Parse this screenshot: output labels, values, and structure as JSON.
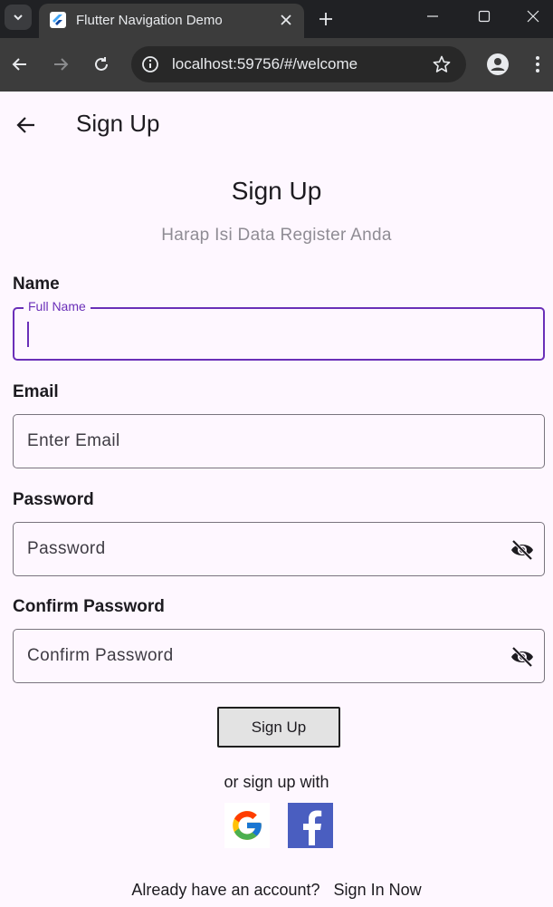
{
  "browser": {
    "tab_title": "Flutter Navigation Demo",
    "url": "localhost:59756/#/welcome"
  },
  "appbar": {
    "title": "Sign Up"
  },
  "header": {
    "title": "Sign Up",
    "subtitle": "Harap Isi Data Register Anda"
  },
  "form": {
    "name": {
      "label": "Name",
      "floating_label": "Full Name",
      "value": ""
    },
    "email": {
      "label": "Email",
      "placeholder": "Enter Email",
      "value": ""
    },
    "password": {
      "label": "Password",
      "placeholder": "Password",
      "value": ""
    },
    "confirm_password": {
      "label": "Confirm Password",
      "placeholder": "Confirm Password",
      "value": ""
    },
    "submit_label": "Sign Up"
  },
  "social": {
    "text": "or sign up with",
    "providers": [
      "google-icon",
      "facebook-icon"
    ]
  },
  "footer": {
    "prompt": "Already have an account?",
    "link": "Sign In Now"
  },
  "colors": {
    "background": "#fef7ff",
    "accent": "#6a2fb8",
    "facebook": "#4a5ec0"
  }
}
